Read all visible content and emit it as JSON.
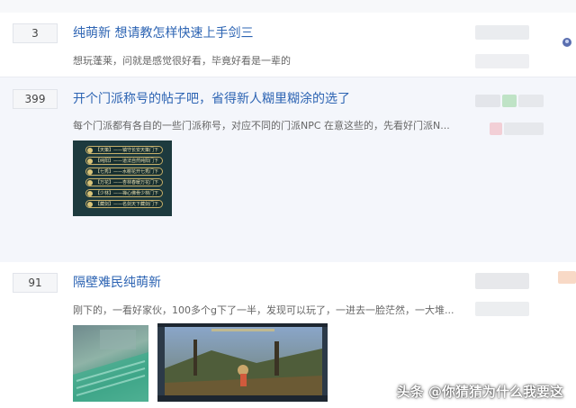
{
  "posts": [
    {
      "replies": "3",
      "title": "纯萌新 想请教怎样快速上手剑三",
      "snippet": "想玩蓬莱，问就是感觉很好看，毕竟好看是一辈的"
    },
    {
      "replies": "399",
      "title": "开个门派称号的帖子吧，省得新人糊里糊涂的选了",
      "snippet": "每个门派都有各自的一些门派称号，对应不同的门派NPC 在意这些的，先看好门派N...",
      "image_lines": [
        "【天策】——镇守长安天策门下",
        "【纯阳】——道法自然纯阳门下",
        "【七秀】——水榭花开七秀门下",
        "【万花】——杏林春暖万花门下",
        "【少林】——禅心佛骨少林门下",
        "【藏剑】——名剑天下藏剑门下"
      ]
    },
    {
      "replies": "91",
      "title": "隔壁难民纯萌新",
      "snippet": "刚下的，一看好家伙，100多个g下了一半，发现可以玩了，一进去一脸茫然，一大堆..."
    }
  ],
  "watermark": "头条 @你猜猜为什么我要这",
  "colors": {
    "title_link": "#2d64b3",
    "snippet": "#666666",
    "highlight_bg": "#f4f6fb"
  }
}
